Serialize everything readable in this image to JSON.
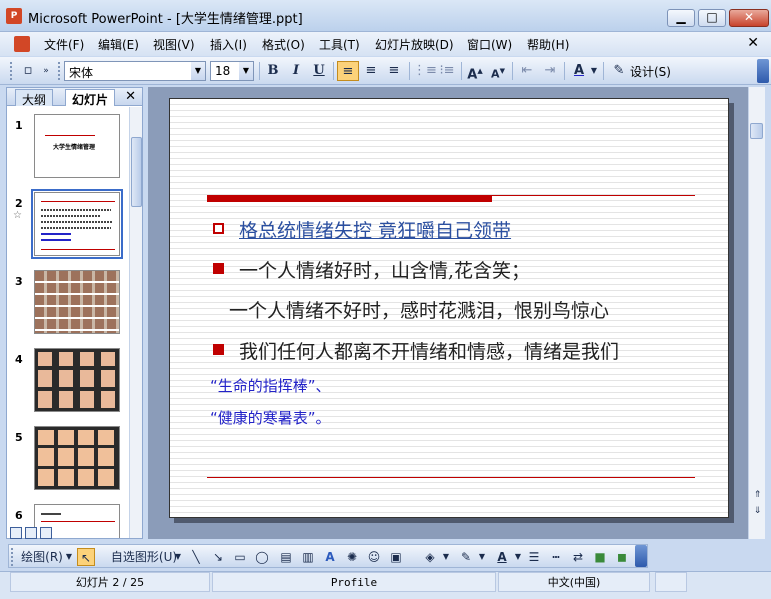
{
  "window": {
    "title": "Microsoft PowerPoint - [大学生情绪管理.ppt]",
    "minimize": "▁",
    "maximize": "□",
    "close": "✕"
  },
  "menu": {
    "items": [
      "文件(F)",
      "编辑(E)",
      "视图(V)",
      "插入(I)",
      "格式(O)",
      "工具(T)",
      "幻灯片放映(D)",
      "窗口(W)",
      "帮助(H)"
    ],
    "doc_close": "✕"
  },
  "toolbar": {
    "font_name": "宋体",
    "font_size": "18",
    "bold": "B",
    "italic": "I",
    "underline": "U",
    "design_label": "设计(S)"
  },
  "left_pane": {
    "tabs": [
      "大纲",
      "幻灯片"
    ],
    "close": "✕",
    "slides": [
      {
        "number": "1",
        "thumb_title": "大学生情绪管理"
      },
      {
        "number": "2"
      },
      {
        "number": "3"
      },
      {
        "number": "4"
      },
      {
        "number": "5"
      },
      {
        "number": "6"
      }
    ],
    "selected_slide": 2
  },
  "slide": {
    "line1": "格总统情绪失控 竟狂嚼自己领带",
    "line2": "一个人情绪好时，山含情,花含笑；",
    "line3": "一个人情绪不好时，感时花溅泪，恨别鸟惊心",
    "line4": "我们任何人都离不开情绪和情感，情绪是我们",
    "line5": "“生命的指挥棒”、",
    "line6": "“健康的寒暑表”。"
  },
  "drawing_toolbar": {
    "draw_label": "绘图(R)",
    "autoshapes_label": "自选图形(U)"
  },
  "status": {
    "slide_position": "幻灯片 2 / 25",
    "template": "Profile",
    "language": "中文(中国)"
  },
  "colors": {
    "accent_red": "#c00000",
    "link_blue": "#2b4fa0",
    "text_blue": "#2323c8"
  }
}
